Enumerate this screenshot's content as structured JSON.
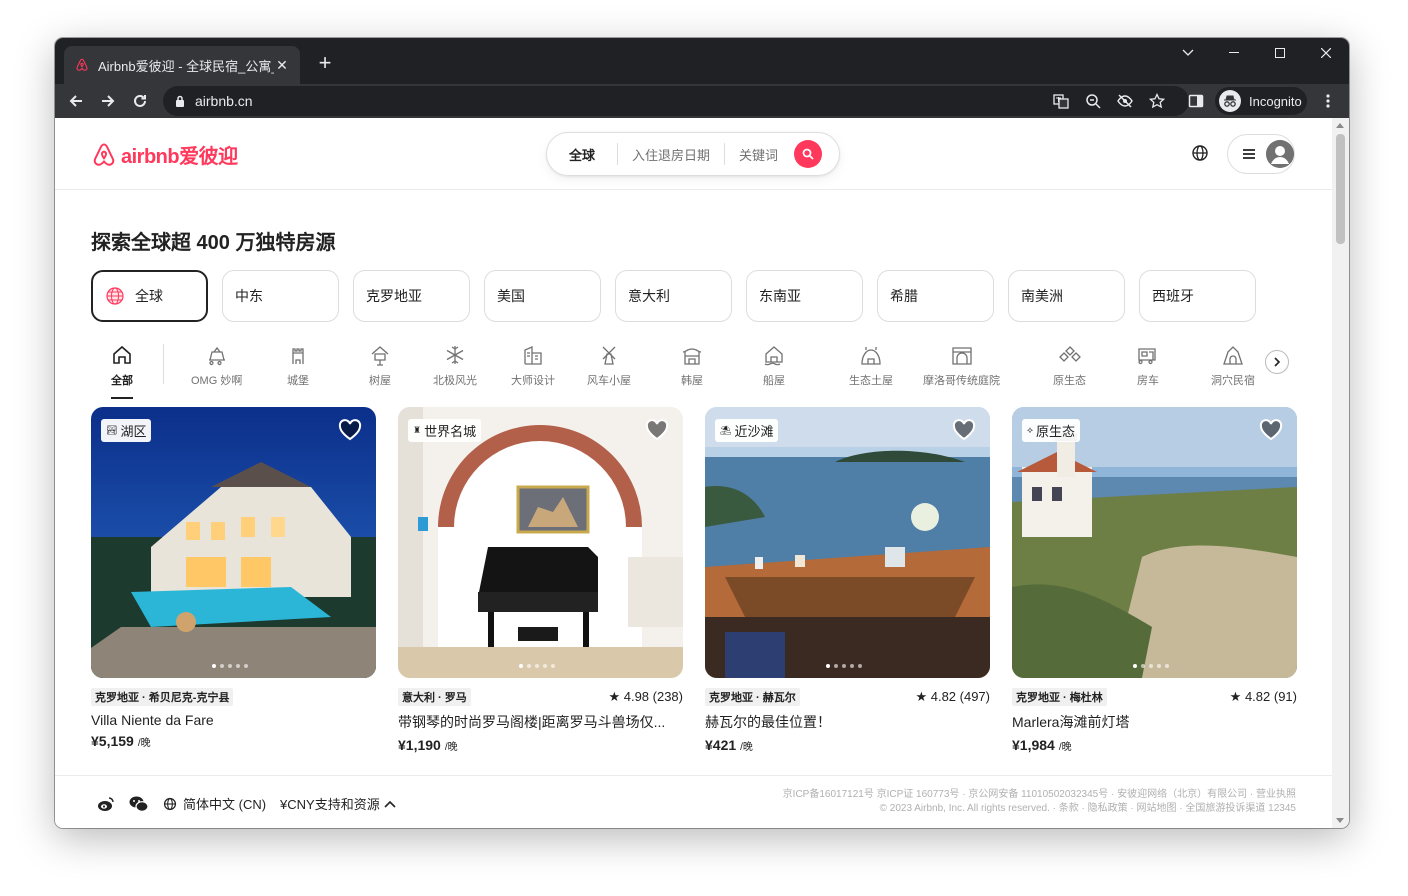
{
  "browser": {
    "tab_title": "Airbnb爱彼迎 - 全球民宿_公寓_短",
    "url": "airbnb.cn",
    "profile_label": "Incognito"
  },
  "header": {
    "logo_text": "airbnb爱彼迎",
    "search": {
      "where": "全球",
      "dates": "入住退房日期",
      "keyword": "关键词"
    }
  },
  "headline": "探索全球超 400 万独特房源",
  "regions": [
    "全球",
    "中东",
    "克罗地亚",
    "美国",
    "意大利",
    "东南亚",
    "希腊",
    "南美洲",
    "西班牙"
  ],
  "categories": [
    "全部",
    "OMG 妙啊",
    "城堡",
    "树屋",
    "北极风光",
    "大师设计",
    "风车小屋",
    "韩屋",
    "船屋",
    "生态土屋",
    "摩洛哥传统庭院",
    "原生态",
    "房车",
    "洞穴民宿"
  ],
  "listings": [
    {
      "badge": "湖区",
      "location": "克罗地亚 · 希贝尼克-克宁县",
      "rating": "",
      "name": "Villa Niente da Fare",
      "price": "¥5,159",
      "unit": "/晚"
    },
    {
      "badge": "世界名城",
      "location": "意大利 · 罗马",
      "rating": "4.98 (238)",
      "name": "带钢琴的时尚罗马阁楼|距离罗马斗兽场仅...",
      "price": "¥1,190",
      "unit": "/晚"
    },
    {
      "badge": "近沙滩",
      "location": "克罗地亚 · 赫瓦尔",
      "rating": "4.82 (497)",
      "name": "赫瓦尔的最佳位置！",
      "price": "¥421",
      "unit": "/晚"
    },
    {
      "badge": "原生态",
      "location": "克罗地亚 · 梅杜林",
      "rating": "4.82 (91)",
      "name": "Marlera海滩前灯塔",
      "price": "¥1,984",
      "unit": "/晚"
    }
  ],
  "footer": {
    "language": "简体中文 (CN)",
    "currency": "¥CNY支持和资源",
    "legal_1": "京ICP备16017121号 京ICP证 160773号 · 京公网安备 11010502032345号 · 安彼迎网络（北京）有限公司 · 营业执照",
    "legal_2": "© 2023 Airbnb, Inc. All rights reserved. · 条款 · 隐私政策 · 网站地图 · 全国旅游投诉渠道 12345"
  }
}
